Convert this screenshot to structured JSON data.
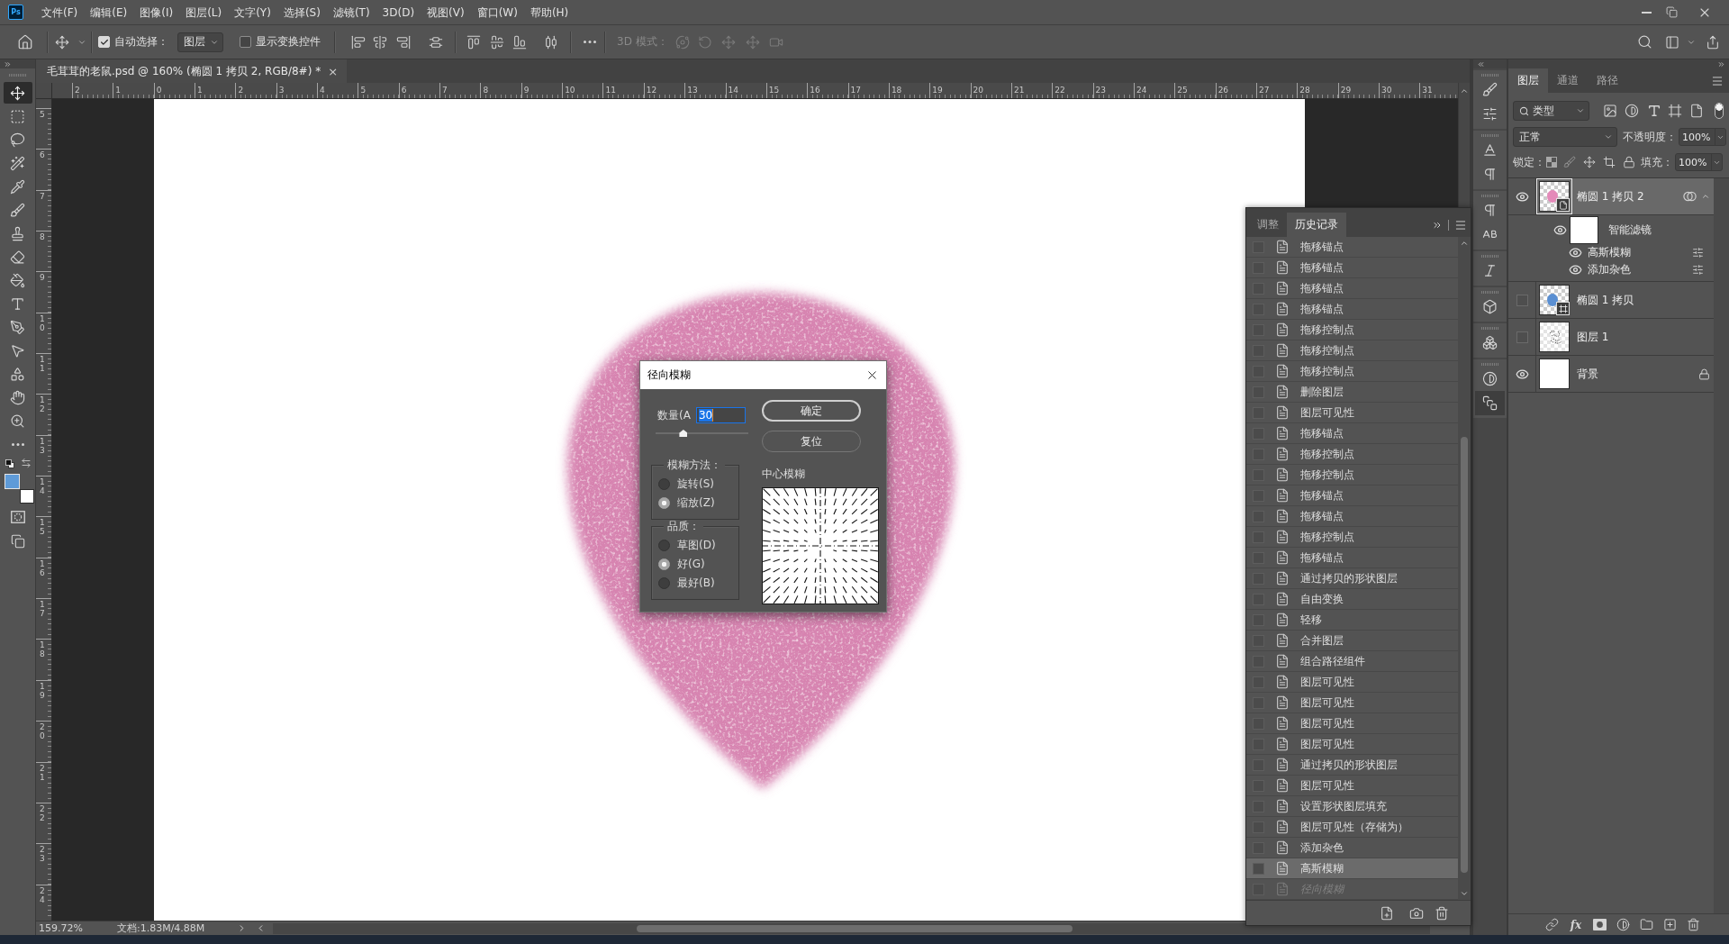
{
  "app_logo": "Ps",
  "menu_bar": {
    "items": [
      "文件(F)",
      "编辑(E)",
      "图像(I)",
      "图层(L)",
      "文字(Y)",
      "选择(S)",
      "滤镜(T)",
      "3D(D)",
      "视图(V)",
      "窗口(W)",
      "帮助(H)"
    ]
  },
  "options_bar": {
    "auto_select": {
      "label": "自动选择：",
      "checked": true
    },
    "auto_select_target": "图层",
    "show_transform_controls": {
      "label": "显示变换控件",
      "checked": false
    },
    "mode_3d": {
      "label": "3D 模式：",
      "disabled": true
    }
  },
  "document_tab": {
    "title": "毛茸茸的老鼠.psd @ 160% (椭圆 1 拷贝 2, RGB/8#) *",
    "close": "×"
  },
  "toolbar": {
    "tools": [
      {
        "kind": "move",
        "selected": true
      },
      {
        "kind": "marquee",
        "selected": false
      },
      {
        "kind": "lasso",
        "selected": false
      },
      {
        "kind": "quick-select",
        "selected": false
      },
      {
        "kind": "eyedropper",
        "selected": false
      },
      {
        "kind": "brush",
        "selected": false
      },
      {
        "kind": "stamp",
        "selected": false
      },
      {
        "kind": "eraser",
        "selected": false
      },
      {
        "kind": "bucket",
        "selected": false
      },
      {
        "kind": "type",
        "selected": false
      },
      {
        "kind": "pen",
        "selected": false
      },
      {
        "kind": "path-select",
        "selected": false
      },
      {
        "kind": "shape",
        "selected": false
      },
      {
        "kind": "hand",
        "selected": false
      },
      {
        "kind": "zoom",
        "selected": false
      },
      {
        "kind": "more",
        "selected": false
      }
    ],
    "foreground": {
      "color": "#5f9bd8"
    },
    "background": {
      "color": "#ffffff"
    }
  },
  "rulers": {
    "horizontal": [
      "2",
      "1",
      "0",
      "1",
      "2",
      "3",
      "4",
      "5",
      "6",
      "7",
      "8",
      "9",
      "10",
      "11",
      "12",
      "13",
      "14",
      "15",
      "16",
      "17",
      "18",
      "19",
      "20",
      "21",
      "22",
      "23",
      "24",
      "25",
      "26",
      "27",
      "28",
      "29",
      "30",
      "31"
    ],
    "vertical": [
      "5",
      "6",
      "7",
      "8",
      "9",
      "10",
      "11",
      "12",
      "13",
      "14",
      "15",
      "16",
      "17",
      "18",
      "19",
      "20",
      "21",
      "22",
      "23",
      "24"
    ]
  },
  "radial_blur_dialog": {
    "title": "径向模糊",
    "amount_label": "数量(A",
    "amount": "30",
    "level": 0.3,
    "buttons": [
      {
        "label": "确定",
        "default": true
      },
      {
        "label": "复位",
        "default": false
      }
    ],
    "groups": [
      {
        "legend": "模糊方法：",
        "options": [
          {
            "label": "旋转(S)",
            "selected": false
          },
          {
            "label": "缩放(Z)",
            "selected": true
          }
        ]
      },
      {
        "legend": "品质：",
        "options": [
          {
            "label": "草图(D)",
            "selected": false
          },
          {
            "label": "好(G)",
            "selected": true
          },
          {
            "label": "最好(B)",
            "selected": false
          }
        ]
      }
    ],
    "preview_label": "中心模糊"
  },
  "history_panel": {
    "tabs": [
      {
        "label": "调整",
        "selected": false
      },
      {
        "label": "历史记录",
        "selected": true
      }
    ],
    "items": [
      {
        "label": "拖移锚点",
        "selected": false,
        "disabled": false
      },
      {
        "label": "拖移锚点",
        "selected": false,
        "disabled": false
      },
      {
        "label": "拖移锚点",
        "selected": false,
        "disabled": false
      },
      {
        "label": "拖移锚点",
        "selected": false,
        "disabled": false
      },
      {
        "label": "拖移控制点",
        "selected": false,
        "disabled": false
      },
      {
        "label": "拖移控制点",
        "selected": false,
        "disabled": false
      },
      {
        "label": "拖移控制点",
        "selected": false,
        "disabled": false
      },
      {
        "label": "删除图层",
        "selected": false,
        "disabled": false
      },
      {
        "label": "图层可见性",
        "selected": false,
        "disabled": false
      },
      {
        "label": "拖移锚点",
        "selected": false,
        "disabled": false
      },
      {
        "label": "拖移控制点",
        "selected": false,
        "disabled": false
      },
      {
        "label": "拖移控制点",
        "selected": false,
        "disabled": false
      },
      {
        "label": "拖移锚点",
        "selected": false,
        "disabled": false
      },
      {
        "label": "拖移锚点",
        "selected": false,
        "disabled": false
      },
      {
        "label": "拖移控制点",
        "selected": false,
        "disabled": false
      },
      {
        "label": "拖移锚点",
        "selected": false,
        "disabled": false
      },
      {
        "label": "通过拷贝的形状图层",
        "selected": false,
        "disabled": false
      },
      {
        "label": "自由变换",
        "selected": false,
        "disabled": false
      },
      {
        "label": "轻移",
        "selected": false,
        "disabled": false
      },
      {
        "label": "合并图层",
        "selected": false,
        "disabled": false
      },
      {
        "label": "组合路径组件",
        "selected": false,
        "disabled": false
      },
      {
        "label": "图层可见性",
        "selected": false,
        "disabled": false
      },
      {
        "label": "图层可见性",
        "selected": false,
        "disabled": false
      },
      {
        "label": "图层可见性",
        "selected": false,
        "disabled": false
      },
      {
        "label": "图层可见性",
        "selected": false,
        "disabled": false
      },
      {
        "label": "通过拷贝的形状图层",
        "selected": false,
        "disabled": false
      },
      {
        "label": "图层可见性",
        "selected": false,
        "disabled": false
      },
      {
        "label": "设置形状图层填充",
        "selected": false,
        "disabled": false
      },
      {
        "label": "图层可见性（存储为）",
        "selected": false,
        "disabled": false
      },
      {
        "label": "添加杂色",
        "selected": false,
        "disabled": false
      },
      {
        "label": "高斯模糊",
        "selected": true,
        "disabled": false
      },
      {
        "label": "径向模糊",
        "selected": false,
        "disabled": true
      }
    ]
  },
  "layers_panel": {
    "tabs": [
      {
        "label": "图层",
        "selected": true
      },
      {
        "label": "通道",
        "selected": false
      },
      {
        "label": "路径",
        "selected": false
      }
    ],
    "filter_kind": "类型",
    "filter_on": true,
    "blend_mode": "正常",
    "opacity_label": "不透明度：",
    "opacity": "100%",
    "lock_label": "锁定：",
    "fill_label": "填充：",
    "fill": "100%",
    "footer_fx": "fx",
    "layers": [
      {
        "kind": "smart-object",
        "name": "椭圆 1 拷贝 2",
        "visible": true,
        "selected": true,
        "locked": false,
        "smart_filters": {
          "label": "智能滤镜",
          "visible": true,
          "filters": [
            {
              "name": "高斯模糊",
              "visible": true
            },
            {
              "name": "添加杂色",
              "visible": true
            }
          ]
        }
      },
      {
        "kind": "shape",
        "name": "椭圆 1 拷贝",
        "visible": false,
        "selected": false,
        "locked": false
      },
      {
        "kind": "pixel",
        "name": "图层 1",
        "visible": false,
        "selected": false,
        "locked": false
      },
      {
        "kind": "background",
        "name": "背景",
        "visible": true,
        "selected": false,
        "locked": true
      }
    ]
  },
  "status_bar": {
    "zoom": "159.72%",
    "document_size": "文档:1.83M/4.88M"
  }
}
